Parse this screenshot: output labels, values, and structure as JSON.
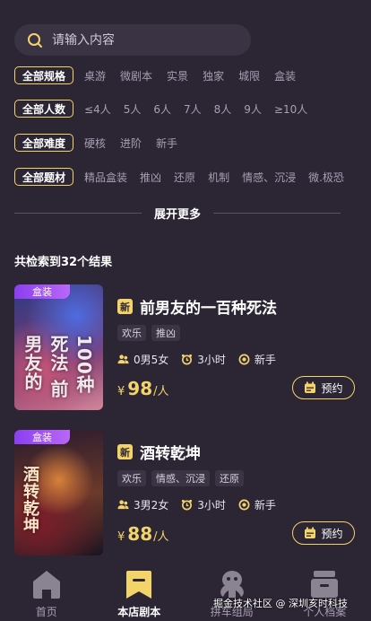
{
  "search": {
    "placeholder": "请输入内容"
  },
  "filters": [
    {
      "all_label": "全部规格",
      "options": [
        "桌游",
        "微剧本",
        "实景",
        "独家",
        "城限",
        "盒装"
      ]
    },
    {
      "all_label": "全部人数",
      "options": [
        "≤4人",
        "5人",
        "6人",
        "7人",
        "8人",
        "9人",
        "≥10人"
      ]
    },
    {
      "all_label": "全部难度",
      "options": [
        "硬核",
        "进阶",
        "新手"
      ]
    },
    {
      "all_label": "全部题材",
      "options": [
        "精品盒装",
        "推凶",
        "还原",
        "机制",
        "情感、沉浸",
        "微.极恐"
      ]
    }
  ],
  "expand_more": "展开更多",
  "result_count": "共检索到32个结果",
  "scripts": [
    {
      "tag": "盒装",
      "poster_text": "100种死法 前男友的",
      "new_badge": "新",
      "title": "前男友的一百种死法",
      "genres": [
        "欢乐",
        "推凶"
      ],
      "players": "0男5女",
      "duration": "3小时",
      "level": "新手",
      "currency": "¥",
      "price": "98",
      "price_unit": "/人",
      "book_label": "预约"
    },
    {
      "tag": "盒装",
      "poster_text": "酒转乾坤",
      "new_badge": "新",
      "title": "酒转乾坤",
      "genres": [
        "欢乐",
        "情感、沉浸",
        "还原"
      ],
      "players": "3男2女",
      "duration": "3小时",
      "level": "新手",
      "currency": "¥",
      "price": "88",
      "price_unit": "/人",
      "book_label": "预约"
    }
  ],
  "tabbar": [
    {
      "label": "首页",
      "icon": "home-icon",
      "active": false
    },
    {
      "label": "本店剧本",
      "icon": "bookmark-icon",
      "active": true
    },
    {
      "label": "拼车组局",
      "icon": "ghost-icon",
      "active": false
    },
    {
      "label": "个人档案",
      "icon": "archive-icon",
      "active": false
    }
  ],
  "watermark": "掘金技术社区 @ 深圳亥时科技",
  "colors": {
    "background": "#2b2534",
    "accent": "#f3d46a",
    "tag_purple": "#9b4ff3",
    "muted": "#a89fb3"
  }
}
